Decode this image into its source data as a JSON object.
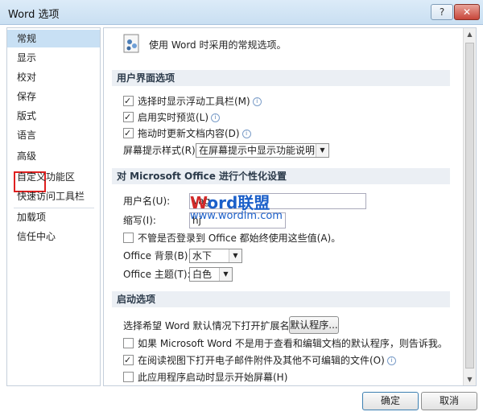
{
  "window": {
    "title": "Word 选项",
    "help_label": "?",
    "close_label": "✕"
  },
  "sidebar": {
    "items": [
      {
        "label": "常规"
      },
      {
        "label": "显示"
      },
      {
        "label": "校对"
      },
      {
        "label": "保存"
      },
      {
        "label": "版式"
      },
      {
        "label": "语言"
      },
      {
        "label": "高级"
      },
      {
        "label": "自定义功能区"
      },
      {
        "label": "快速访问工具栏"
      },
      {
        "label": "加载项"
      },
      {
        "label": "信任中心"
      }
    ],
    "selected": "常规"
  },
  "header": {
    "text": "使用 Word 时采用的常规选项。"
  },
  "ui_section": {
    "title": "用户界面选项",
    "options": [
      {
        "label": "选择时显示浮动工具栏(M)",
        "checked": true
      },
      {
        "label": "启用实时预览(L)",
        "checked": true
      },
      {
        "label": "拖动时更新文档内容(D)",
        "checked": true
      }
    ],
    "tooltip_label": "屏幕提示样式(R):",
    "tooltip_value": "在屏幕提示中显示功能说明"
  },
  "personalize_section": {
    "title": "对 Microsoft Office 进行个性化设置",
    "username_label": "用户名(U):",
    "username_value": "Vag",
    "initials_label": "缩写(I):",
    "initials_value": "hj",
    "always_use_label": "不管是否登录到 Office 都始终使用这些值(A)。",
    "always_use_checked": false,
    "background_label": "Office 背景(B):",
    "background_value": "水下",
    "theme_label": "Office 主题(T):",
    "theme_value": "白色"
  },
  "startup_section": {
    "title": "启动选项",
    "extensions_label": "选择希望 Word 默认情况下打开扩展名:",
    "default_programs_button": "默认程序...",
    "options": [
      {
        "label": "如果 Microsoft Word 不是用于查看和编辑文档的默认程序，则告诉我。",
        "checked": false
      },
      {
        "label": "在阅读视图下打开电子邮件附件及其他不可编辑的文件(O)",
        "checked": true
      },
      {
        "label": "此应用程序启动时显示开始屏幕(H)",
        "checked": false
      }
    ]
  },
  "watermark": {
    "brand_w": "W",
    "brand_rest": "ord联盟",
    "url": "www.wordlm.com"
  },
  "footer": {
    "ok_label": "确定",
    "cancel_label": "取消"
  },
  "colors": {
    "selected_nav": "#c8e0f4",
    "highlight_box": "#e02020",
    "watermark_red": "#d32a2a",
    "watermark_blue": "#1b5fc9"
  }
}
